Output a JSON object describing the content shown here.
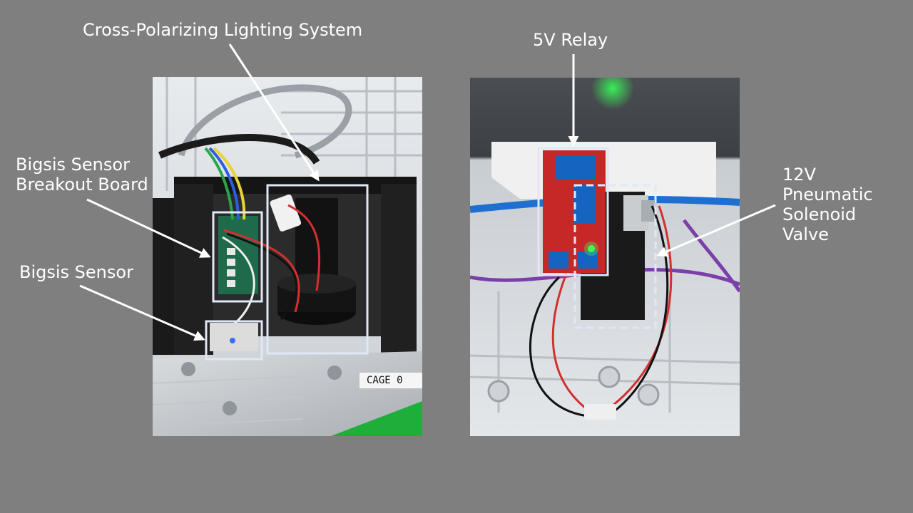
{
  "labels": {
    "cross_polarizing": "Cross-Polarizing Lighting System",
    "breakout_line1": "Bigsis Sensor",
    "breakout_line2": "Breakout Board",
    "bigsis_sensor": "Bigsis Sensor",
    "relay": "5V Relay",
    "valve_line1": "12V",
    "valve_line2": "Pneumatic",
    "valve_line3": "Solenoid",
    "valve_line4": "Valve",
    "cage_plate": "CAGE 0"
  },
  "colors": {
    "background": "#7f7f7f",
    "label_text": "#ffffff",
    "annotation_box": "#dfe8f5",
    "relay_board": "#c62828",
    "relay_block": "#1565c0",
    "led_green": "#39ff5a",
    "led_blue": "#3b6cff",
    "wire_red": "#d32f2f",
    "wire_black": "#111111",
    "tube_blue": "#1e6fd0",
    "tube_purple": "#7b3fa8",
    "base_green": "#1fae3a"
  }
}
